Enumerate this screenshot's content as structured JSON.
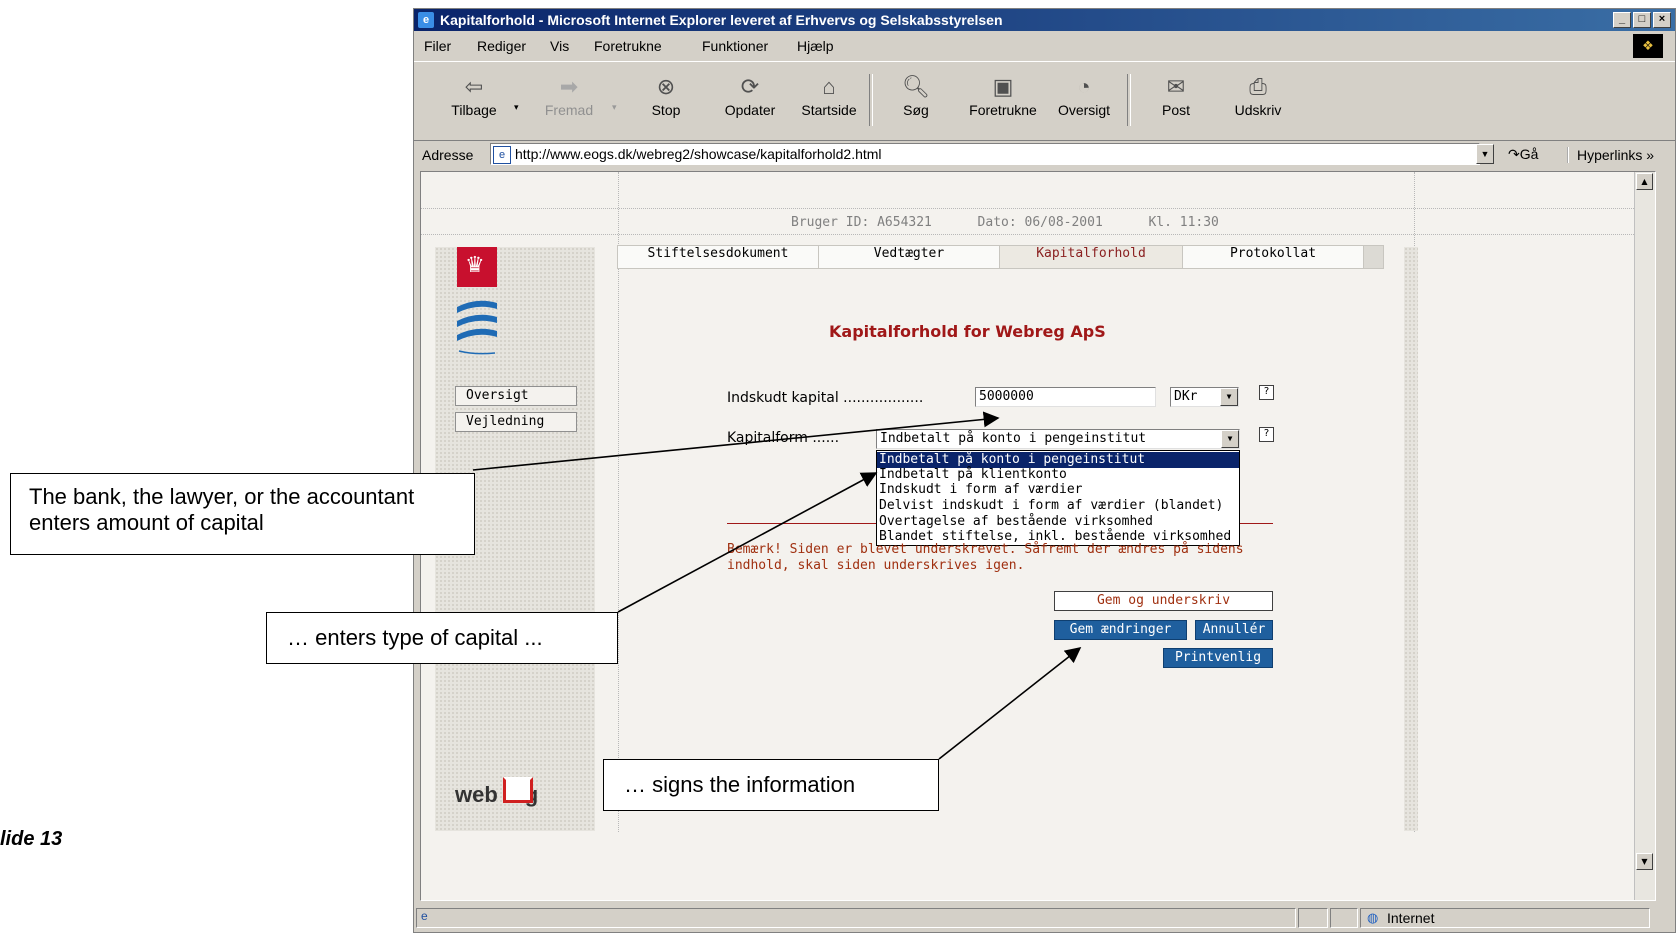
{
  "window": {
    "title": "Kapitalforhold - Microsoft Internet Explorer leveret af Erhvervs og Selskabsstyrelsen",
    "minimize": "_",
    "maximize": "□",
    "close": "×"
  },
  "menubar": [
    "Filer",
    "Rediger",
    "Vis",
    "Foretrukne",
    "Funktioner",
    "Hjælp"
  ],
  "toolbar": {
    "back": "Tilbage",
    "forward": "Fremad",
    "stop": "Stop",
    "refresh": "Opdater",
    "home": "Startside",
    "search": "Søg",
    "favorites": "Foretrukne",
    "history": "Oversigt",
    "mail": "Post",
    "print": "Udskriv"
  },
  "addressbar": {
    "label": "Adresse",
    "url": "http://www.eogs.dk/webreg2/showcase/kapitalforhold2.html",
    "go": "Gå",
    "links": "Hyperlinks"
  },
  "page": {
    "header": {
      "user": "Bruger ID: A654321",
      "date": "Dato: 06/08-2001",
      "time": "Kl. 11:30"
    },
    "sidebar": {
      "overview": "Oversigt",
      "guide": "Vejledning",
      "logo": "web reg"
    },
    "tabs": [
      {
        "label": "Stiftelsesdokument"
      },
      {
        "label": "Vedtægter"
      },
      {
        "label": "Kapitalforhold"
      },
      {
        "label": "Protokollat"
      }
    ],
    "title": "Kapitalforhold for Webreg ApS",
    "form": {
      "capital_label": "Indskudt kapital ..................",
      "capital_value": "5000000",
      "currency": "DKr",
      "type_label": "Kapitalform ......",
      "type_selected": "Indbetalt på konto i pengeinstitut",
      "help": "?",
      "options": [
        "Indbetalt på konto i pengeinstitut",
        "Indbetalt på klientkonto",
        "Indskudt i form af værdier",
        "Delvist indskudt i form af værdier (blandet)",
        "Overtagelse af bestående virksomhed",
        "Blandet stiftelse, inkl. bestående virksomhed"
      ]
    },
    "remark": "Bemærk! Siden er blevet underskrevet. Såfremt der ændres på sidens indhold, skal siden underskrives igen.",
    "buttons": {
      "sign": "Gem og underskriv",
      "save": "Gem ændringer",
      "cancel": "Annullér",
      "print": "Printvenlig"
    }
  },
  "statusbar": {
    "zone": "Internet"
  },
  "callouts": {
    "capital": "The bank, the lawyer, or the accountant enters amount of capital",
    "type": "… enters type of capital ...",
    "sign": "… signs the information"
  },
  "slide": {
    "number": "lide 13"
  },
  "colors": {
    "accent_red": "#a01818",
    "button_blue": "#1f5f9e",
    "title_bar": "#0a246a"
  }
}
